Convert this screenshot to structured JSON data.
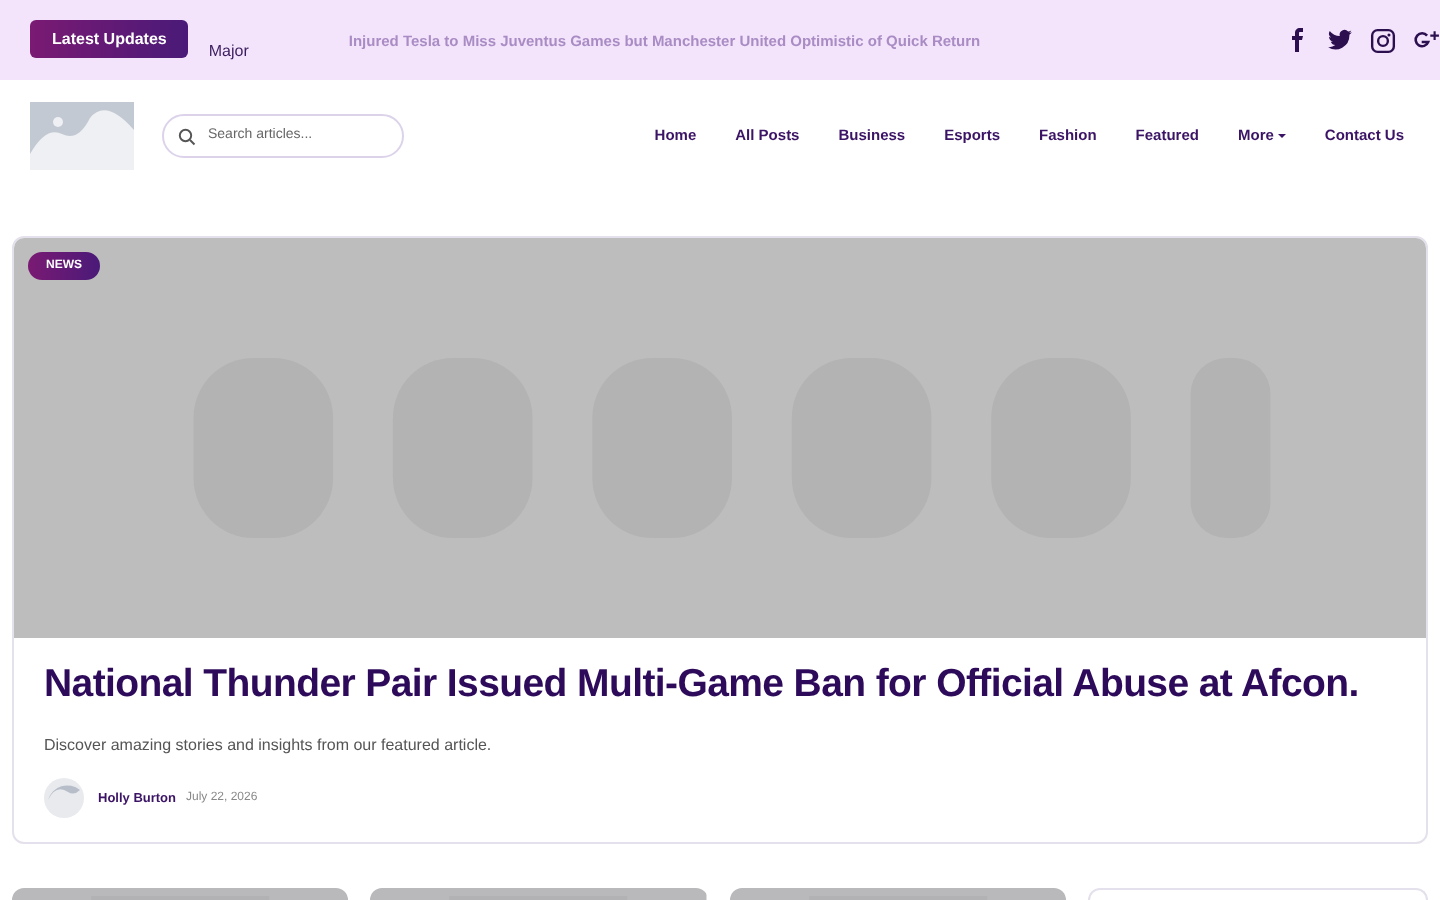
{
  "top_bar": {
    "badge": "Latest Updates",
    "ticker_label": "Major",
    "ticker_text": "Injured Tesla to Miss Juventus Games but Manchester United Optimistic of Quick Return",
    "social": [
      {
        "kind": "facebook"
      },
      {
        "kind": "twitter"
      },
      {
        "kind": "instagram"
      },
      {
        "kind": "googleplus"
      }
    ]
  },
  "header": {
    "search": {
      "placeholder": "Search articles..."
    },
    "nav": [
      {
        "label": "Home",
        "dropdown": false
      },
      {
        "label": "All Posts",
        "dropdown": false
      },
      {
        "label": "Business",
        "dropdown": false
      },
      {
        "label": "Esports",
        "dropdown": false
      },
      {
        "label": "Fashion",
        "dropdown": false
      },
      {
        "label": "Featured",
        "dropdown": false
      },
      {
        "label": "More",
        "dropdown": true
      },
      {
        "label": "Contact Us",
        "dropdown": false
      }
    ]
  },
  "featured": {
    "category": "NEWS",
    "title": "National Thunder Pair Issued Multi-Game Ban for Official Abuse at Afcon.",
    "summary": "Discover amazing stories and insights from our featured article.",
    "author": "Holly Burton",
    "date": "July 22, 2026"
  },
  "more_cards": [
    {
      "kind": "picture"
    },
    {
      "kind": "picture"
    },
    {
      "kind": "picture"
    },
    {
      "kind": "plain"
    }
  ]
}
